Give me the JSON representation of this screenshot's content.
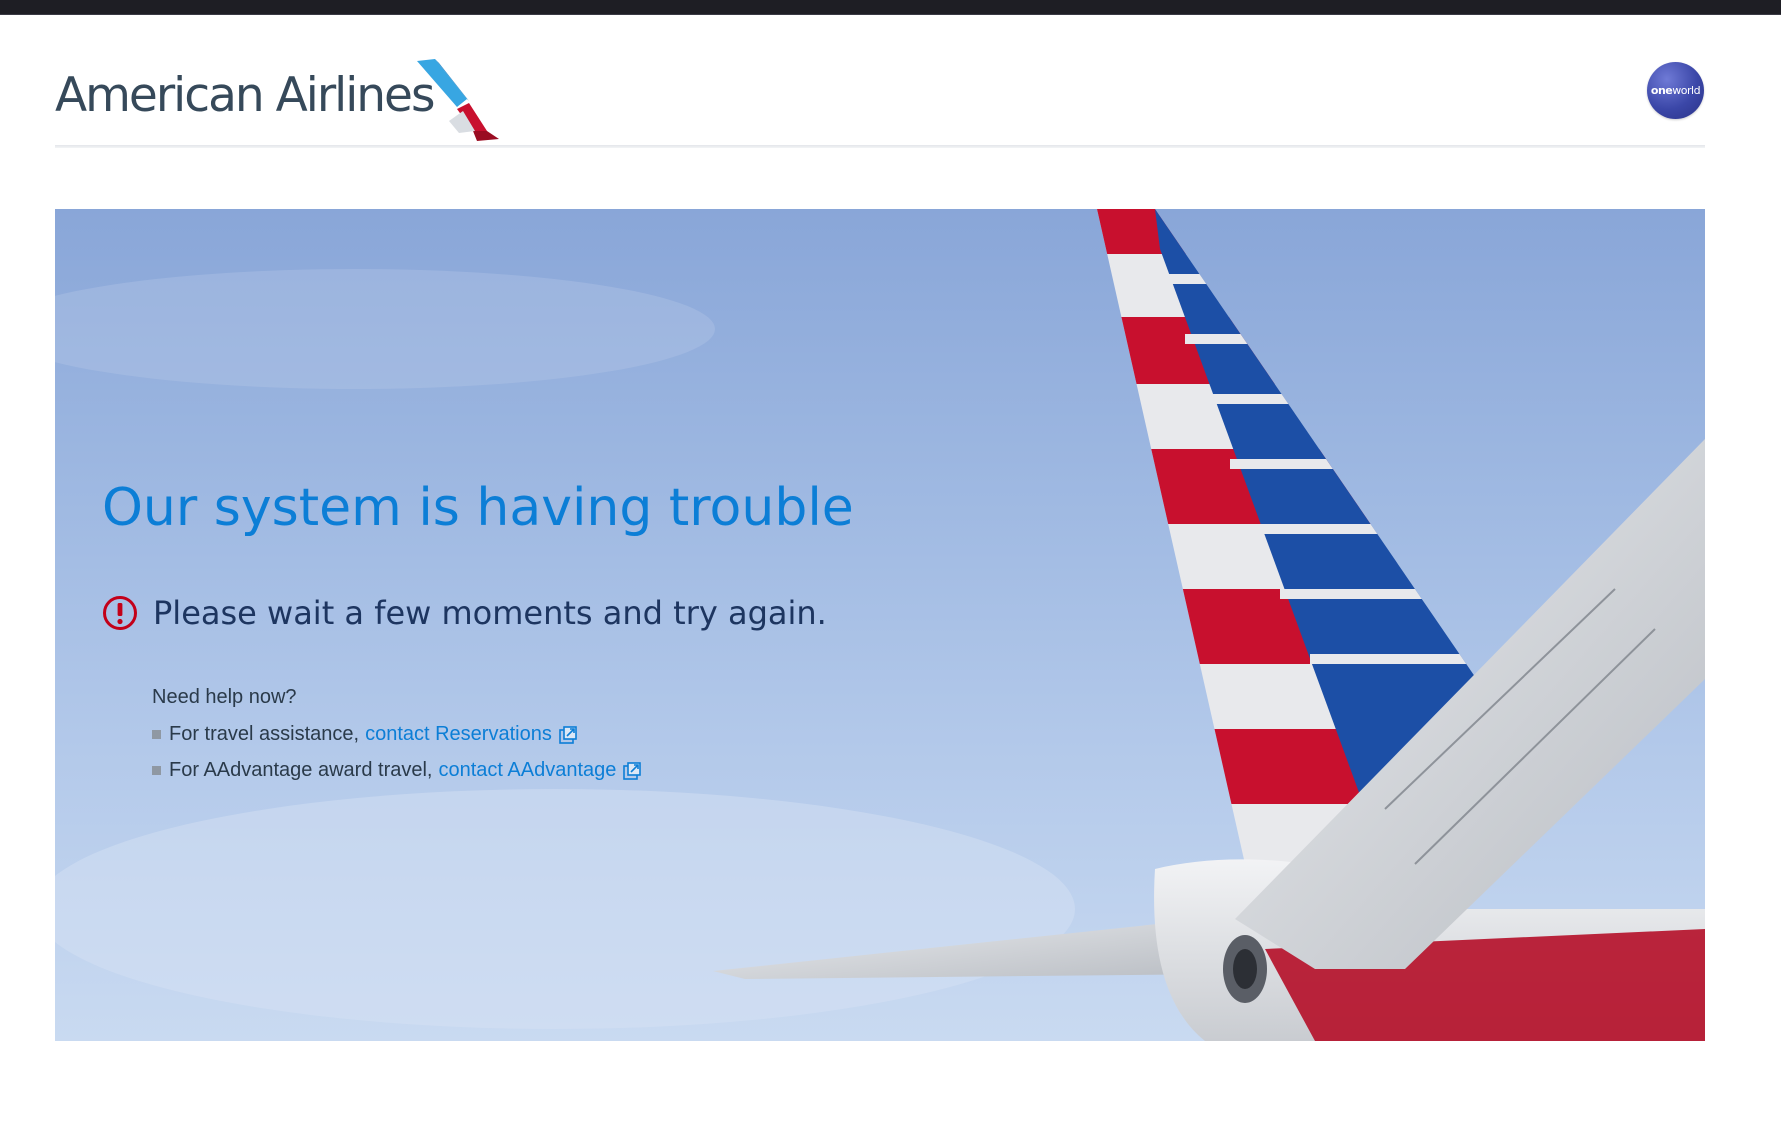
{
  "brand": {
    "name": "American Airlines",
    "partner_badge_prefix": "one",
    "partner_badge_suffix": "world"
  },
  "error": {
    "headline": "Our system is having trouble",
    "message": "Please wait a few moments and try again.",
    "alert_icon": "exclamation-circle-icon"
  },
  "help": {
    "title": "Need help now?",
    "items": [
      {
        "text": "For travel assistance,",
        "link_text": "contact Reservations",
        "link_icon": "external-link-icon"
      },
      {
        "text": "For AAdvantage award travel,",
        "link_text": "contact AAdvantage",
        "link_icon": "external-link-icon"
      }
    ]
  },
  "colors": {
    "headline": "#0c7ed6",
    "message": "#1d3560",
    "link": "#0c7ed6",
    "alert_red": "#c30019",
    "brand_text": "#36495a",
    "oneworld_blue": "#3b47a8"
  }
}
